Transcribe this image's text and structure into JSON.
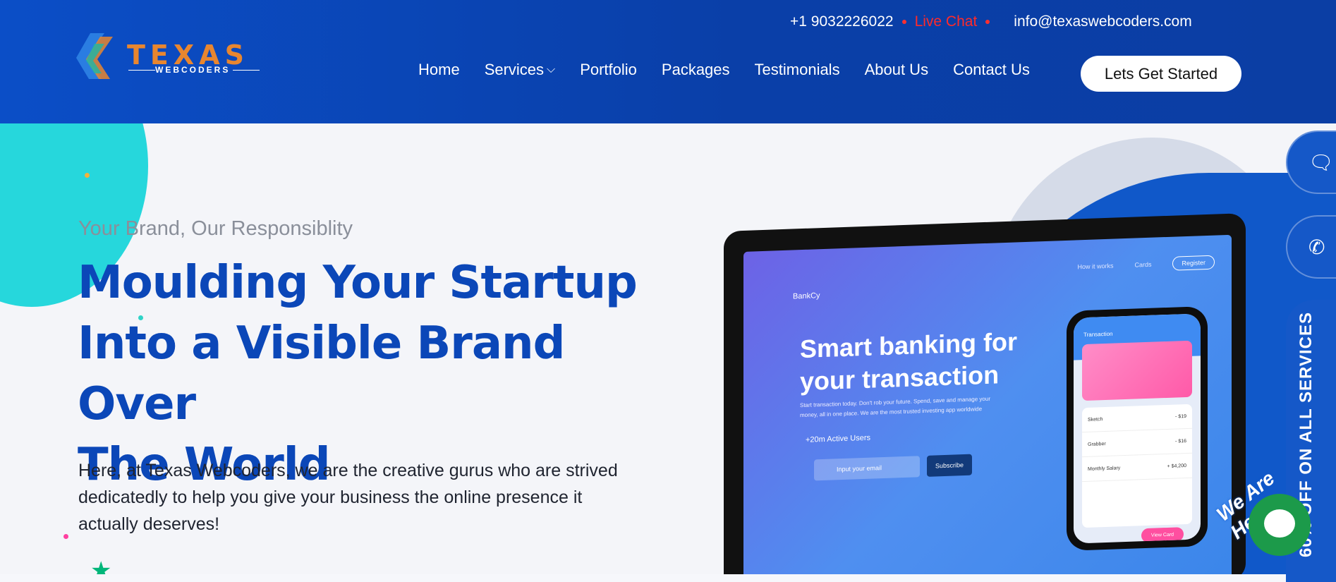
{
  "brand": {
    "name": "TEXAS",
    "sub": "WEBCODERS"
  },
  "contact": {
    "phone": "+1 9032226022",
    "live_chat": "Live Chat",
    "email": "info@texaswebcoders.com"
  },
  "nav": {
    "items": [
      {
        "label": "Home"
      },
      {
        "label": "Services"
      },
      {
        "label": "Portfolio"
      },
      {
        "label": "Packages"
      },
      {
        "label": "Testimonials"
      },
      {
        "label": "About Us"
      },
      {
        "label": "Contact Us"
      }
    ],
    "cta": "Lets Get Started"
  },
  "hero": {
    "tagline": "Your Brand, Our Responsiblity",
    "headline_line1": "Moulding Your Startup",
    "headline_line2": "Into a Visible Brand Over",
    "headline_line3": "The World",
    "body": "Here, at Texas Webcoders, we are the creative gurus who are strived dedicatedly to help you give your business the online presence it actually deserves!"
  },
  "mockup": {
    "logo": "BankCy",
    "nav_1": "How it works",
    "nav_2": "Cards",
    "nav_register": "Register",
    "title": "Smart banking for your transaction",
    "desc": "Start transaction today. Don't rob your future. Spend, save and manage your money, all in one place. We are the most trusted investing app worldwide",
    "users": "+20m Active Users",
    "input_placeholder": "Input your email",
    "subscribe": "Subscribe",
    "phone_title": "Transaction",
    "rows": [
      {
        "name": "Sketch",
        "amount": "- $19"
      },
      {
        "name": "Grabber",
        "amount": "- $16"
      },
      {
        "name": "Monthly Salary",
        "amount": "+ $4,200"
      }
    ],
    "phone_button": "View Card"
  },
  "side": {
    "offer": "60% OFF ON ALL SERVICES",
    "we_are_here": "We Are Here!"
  },
  "colors": {
    "primary": "#0b47b8",
    "accent": "#e8862f",
    "live": "#ff2a2a",
    "cyan": "#26d7dc"
  },
  "icons": [
    "chat-icon",
    "phone-icon",
    "chevron-down-icon",
    "trustpilot-star-icon"
  ]
}
